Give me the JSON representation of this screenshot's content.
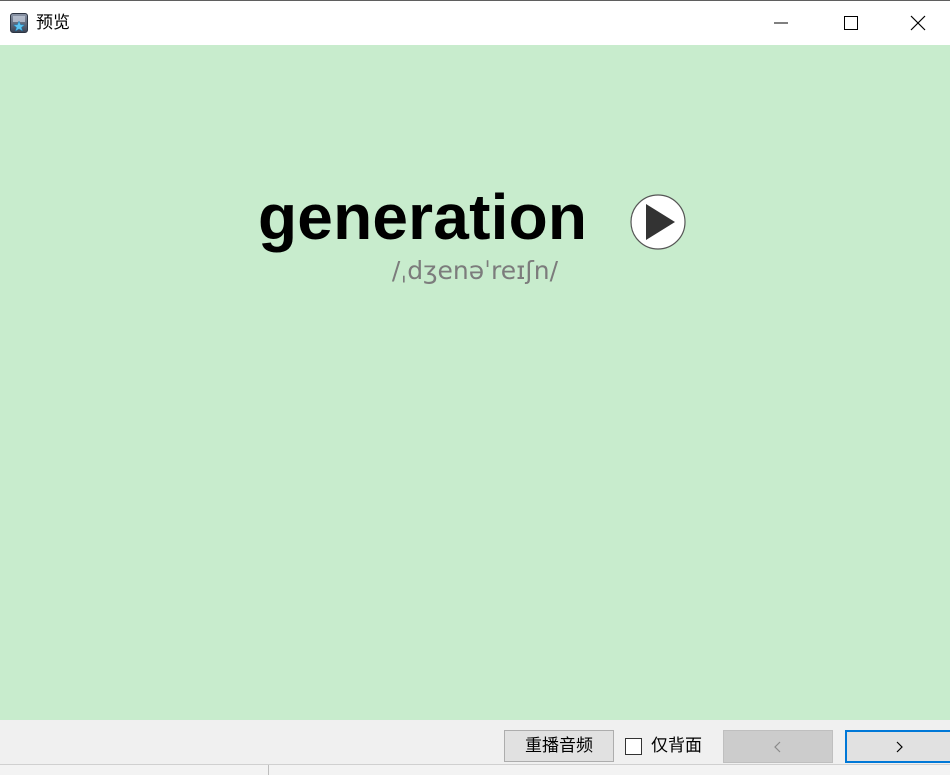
{
  "window": {
    "title": "预览",
    "app_icon": "star-card-app-icon",
    "controls": [
      "minimize-icon",
      "maximize-icon",
      "close-icon"
    ]
  },
  "card": {
    "word": "generation",
    "phonetic": "/ˌdʒenəˈreɪʃn/",
    "play_icon": "play-icon",
    "background_color": "#c8eccd"
  },
  "toolbar": {
    "replay_label": "重播音频",
    "back_only_label": "仅背面",
    "back_only_checked": false,
    "prev_label": "‹",
    "next_label": "›"
  }
}
